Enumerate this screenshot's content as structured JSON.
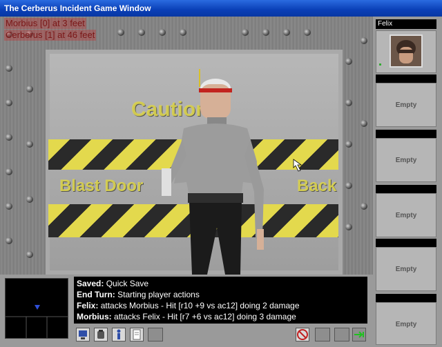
{
  "window": {
    "title": "The Cerberus Incident Game Window"
  },
  "targets": [
    {
      "text": "Morbius [0] at 3 feet"
    },
    {
      "text": "Cerberus [1] at 46 feet"
    }
  ],
  "scene": {
    "sign_line1": "Caution!",
    "sign_line2": "Blast Door",
    "sign_line2b": "Back"
  },
  "party": {
    "active_name": "Felix",
    "slots": [
      {
        "label": "Empty"
      },
      {
        "label": "Empty"
      },
      {
        "label": "Empty"
      },
      {
        "label": "Empty"
      },
      {
        "label": "Empty"
      }
    ]
  },
  "log": [
    {
      "speaker": "Saved:",
      "text": "Quick Save"
    },
    {
      "speaker": "End Turn:",
      "text": "Starting player actions"
    },
    {
      "speaker": "Felix:",
      "text": "attacks Morbius - Hit [r10 +9 vs ac12] doing 2 damage"
    },
    {
      "speaker": "Morbius:",
      "text": "attacks Felix - Hit [r7 +6 vs ac12] doing 3 damage"
    }
  ],
  "toolbar": {
    "icons": [
      "computer-icon",
      "backpack-icon",
      "character-icon",
      "notes-icon",
      "no-action-icon",
      "end-turn-icon"
    ]
  },
  "colors": {
    "title_bar": "#0a3fb6",
    "target_text": "#7a1616",
    "hazard_yellow": "#e3d94d"
  }
}
